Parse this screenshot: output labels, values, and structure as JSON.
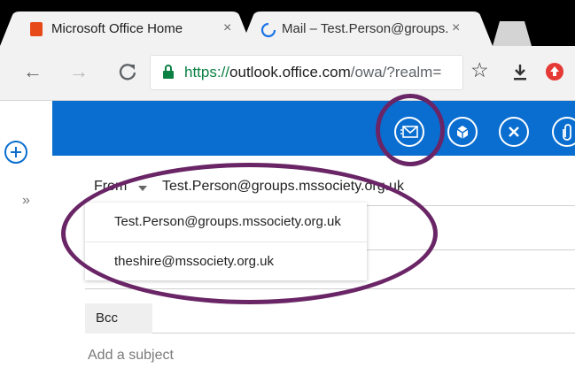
{
  "tabs": [
    {
      "title": "Microsoft Office Home",
      "close": "×"
    },
    {
      "title": "Mail – Test.Person@groups.",
      "close": "×"
    }
  ],
  "address_bar": {
    "url_scheme": "https://",
    "url_host": "outlook.office.com",
    "url_path": "/owa/?realm="
  },
  "compose": {
    "from_label": "From",
    "from_value": "Test.Person@groups.mssociety.org.uk",
    "from_options": [
      "Test.Person@groups.mssociety.org.uk",
      "theshire@mssociety.org.uk"
    ],
    "bcc_label": "Bcc",
    "subject_placeholder": "Add a subject"
  },
  "colors": {
    "accent": "#0a6ed1",
    "annotation": "#6a2566"
  }
}
